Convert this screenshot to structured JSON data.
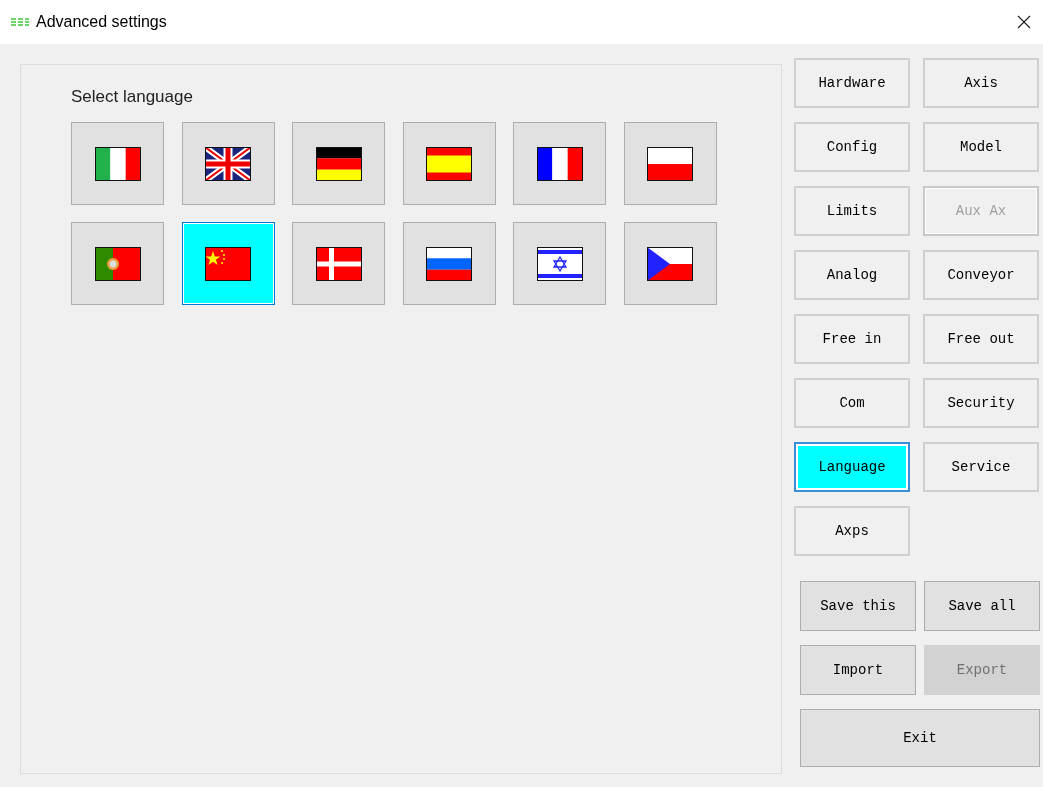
{
  "window": {
    "title": "Advanced settings"
  },
  "panel": {
    "heading": "Select language"
  },
  "flags": [
    {
      "kind": "italy",
      "selected": false
    },
    {
      "kind": "uk",
      "selected": false
    },
    {
      "kind": "germany",
      "selected": false
    },
    {
      "kind": "spain",
      "selected": false
    },
    {
      "kind": "france",
      "selected": false
    },
    {
      "kind": "poland",
      "selected": false
    },
    {
      "kind": "portugal",
      "selected": false
    },
    {
      "kind": "china",
      "selected": true
    },
    {
      "kind": "denmark",
      "selected": false
    },
    {
      "kind": "russia",
      "selected": false
    },
    {
      "kind": "israel",
      "selected": false
    },
    {
      "kind": "czech",
      "selected": false
    }
  ],
  "nav": [
    {
      "label": "Hardware",
      "selected": false,
      "disabled": false
    },
    {
      "label": "Axis",
      "selected": false,
      "disabled": false
    },
    {
      "label": "Config",
      "selected": false,
      "disabled": false
    },
    {
      "label": "Model",
      "selected": false,
      "disabled": false
    },
    {
      "label": "Limits",
      "selected": false,
      "disabled": false
    },
    {
      "label": "Aux Ax",
      "selected": false,
      "disabled": true
    },
    {
      "label": "Analog",
      "selected": false,
      "disabled": false
    },
    {
      "label": "Conveyor",
      "selected": false,
      "disabled": false
    },
    {
      "label": "Free in",
      "selected": false,
      "disabled": false
    },
    {
      "label": "Free out",
      "selected": false,
      "disabled": false
    },
    {
      "label": "Com",
      "selected": false,
      "disabled": false
    },
    {
      "label": "Security",
      "selected": false,
      "disabled": false
    },
    {
      "label": "Language",
      "selected": true,
      "disabled": false
    },
    {
      "label": "Service",
      "selected": false,
      "disabled": false
    },
    {
      "label": "Axps",
      "selected": false,
      "disabled": false
    }
  ],
  "actions": [
    {
      "label": "Save this",
      "disabled": false
    },
    {
      "label": "Save all",
      "disabled": false
    },
    {
      "label": "Import",
      "disabled": false
    },
    {
      "label": "Export",
      "disabled": true
    }
  ],
  "exit": {
    "label": "Exit"
  }
}
